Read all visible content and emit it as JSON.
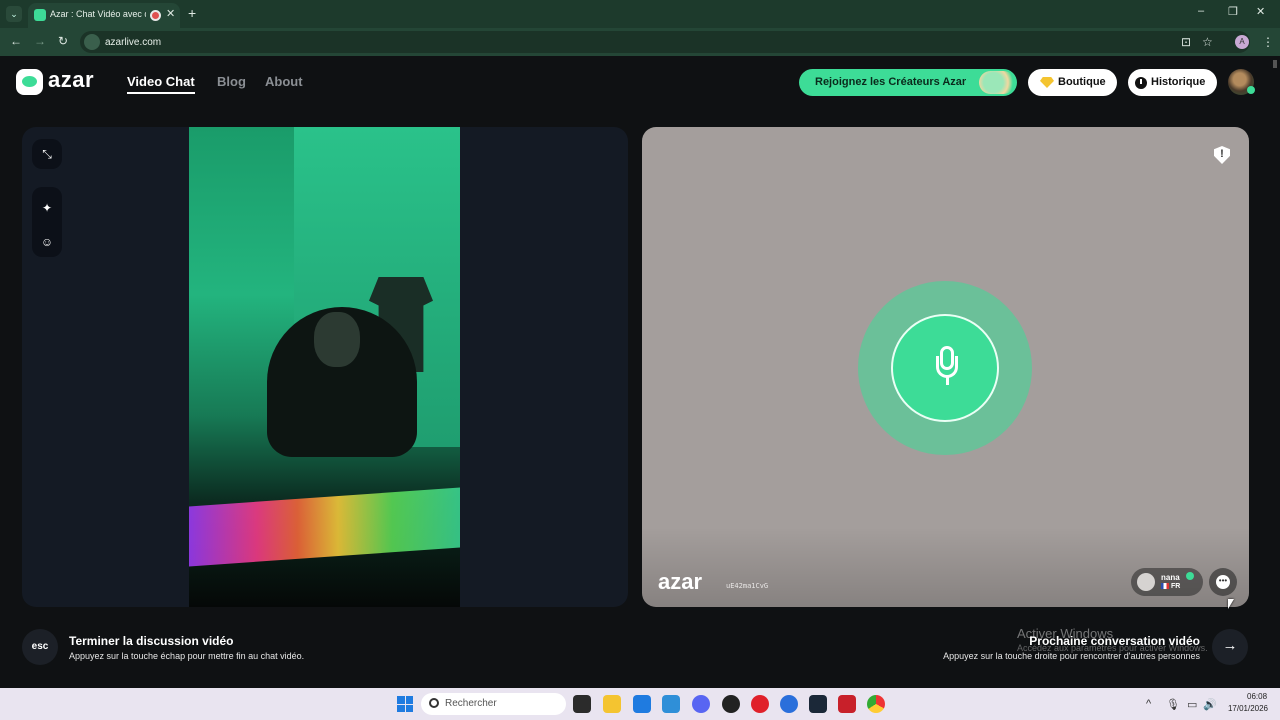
{
  "browser": {
    "tab_title": "Azar : Chat Vidéo avec de n",
    "tab_close": "✕",
    "new_tab": "+",
    "tab_dropdown": "⌄",
    "url": "azarlive.com",
    "profile_initial": "A",
    "window_controls": {
      "minimize": "–",
      "restore": "❐",
      "close": "✕"
    },
    "nav": {
      "back": "←",
      "forward": "→",
      "reload": "↻"
    },
    "icons": {
      "install": "⊡",
      "bookmark": "☆",
      "menu": "⋮"
    }
  },
  "header": {
    "logo": "azar",
    "nav": [
      {
        "label": "Video Chat",
        "active": true
      },
      {
        "label": "Blog",
        "active": false
      },
      {
        "label": "About",
        "active": false
      }
    ],
    "creators_button": "Rejoignez les Créateurs Azar",
    "shop_button": "Boutique",
    "history_button": "Historique"
  },
  "left_tools": {
    "expand": "⤡",
    "effects": "✦",
    "face": "☺"
  },
  "partner": {
    "report": "!",
    "watermark": "azar",
    "watermark_id": "uE42ma1CvG",
    "name": "nana",
    "country": "FR",
    "chat_icon": "•••"
  },
  "footer": {
    "esc_key": "esc",
    "end_title": "Terminer la discussion vidéo",
    "end_sub": "Appuyez sur la touche échap pour mettre fin au chat vidéo.",
    "next_title": "Prochaine conversation vidéo",
    "next_sub": "Appuyez sur la touche droite pour rencontrer d'autres personnes",
    "next_arrow": "→",
    "activate_title": "Activer Windows",
    "activate_sub": "Accédez aux paramètres pour activer Windows."
  },
  "taskbar": {
    "search_placeholder": "Rechercher",
    "time": "06:08",
    "date": "17/01/2026",
    "tray": {
      "chevron": "^",
      "mic": "🎙",
      "display": "▭",
      "volume": "🔊"
    }
  },
  "colors": {
    "accent": "#3ddc97",
    "background": "#0f1113",
    "partner_bg": "#a49e9c"
  }
}
